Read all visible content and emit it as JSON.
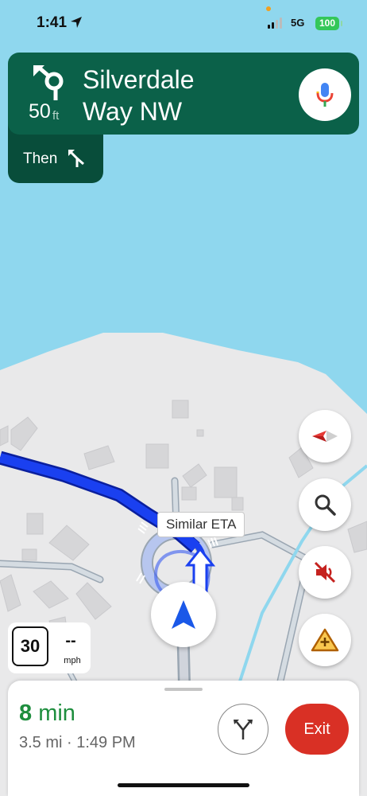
{
  "status_bar": {
    "time": "1:41",
    "network": "5G",
    "battery": "100",
    "icons": [
      "location-arrow-icon",
      "signal-bars-icon"
    ]
  },
  "navigation": {
    "distance_value": "50",
    "distance_unit": "ft",
    "street_line1": "Silverdale",
    "street_line2": "Way NW",
    "then_label": "Then",
    "maneuver_icon": "roundabout-turn-icon",
    "then_icon": "fork-turn-icon",
    "mic_icon": "mic-icon"
  },
  "map": {
    "eta_tag": "Similar ETA",
    "buttons": [
      "compass-icon",
      "search-icon",
      "sound-off-icon",
      "report-icon"
    ]
  },
  "speed": {
    "limit": "30",
    "current": "--",
    "unit": "mph"
  },
  "trip": {
    "eta_minutes": "8",
    "eta_unit": "min",
    "details": "3.5 mi · 1:49 PM",
    "exit_label": "Exit"
  },
  "colors": {
    "nav_green": "#0b6149",
    "water": "#8fd7ee",
    "route_blue": "#1a40f0",
    "eta_green": "#1e8e3e",
    "exit_red": "#d93025"
  }
}
